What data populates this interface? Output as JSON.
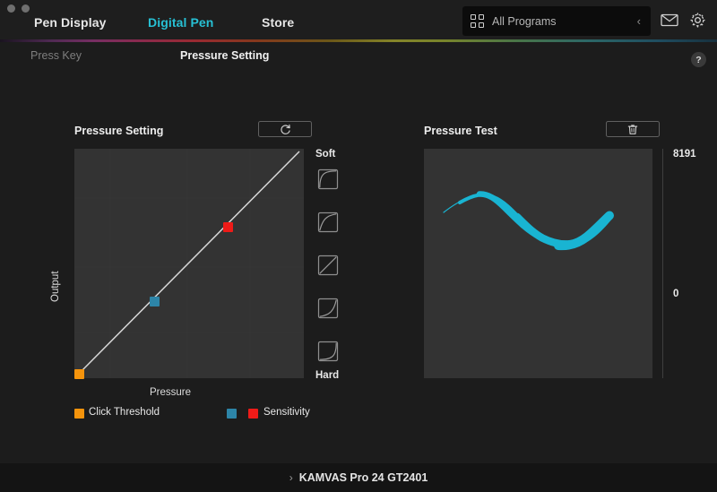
{
  "window": {
    "controls": [
      "close-dot",
      "minimize-dot"
    ]
  },
  "topnav": {
    "items": [
      {
        "label": "Pen Display",
        "active": false
      },
      {
        "label": "Digital Pen",
        "active": true
      },
      {
        "label": "Store",
        "active": false
      }
    ],
    "program_selector": {
      "icon": "grid-icon",
      "label": "All Programs",
      "chevron": "‹"
    },
    "mail_icon": "mail-icon",
    "settings_icon": "gear-icon",
    "accent_color": "#27c0d4"
  },
  "subnav": {
    "items": [
      {
        "label": "Press Key",
        "active": false
      },
      {
        "label": "Pressure Setting",
        "active": true
      }
    ],
    "help_label": "?"
  },
  "pressure_setting": {
    "title": "Pressure Setting",
    "reset_icon": "refresh-icon",
    "axis_y": "Output",
    "axis_x": "Pressure",
    "soft_label": "Soft",
    "hard_label": "Hard",
    "presets": [
      {
        "name": "preset-soft-1",
        "shape": "concave-strong"
      },
      {
        "name": "preset-soft-2",
        "shape": "concave-light"
      },
      {
        "name": "preset-linear",
        "shape": "linear"
      },
      {
        "name": "preset-hard-2",
        "shape": "convex-light"
      },
      {
        "name": "preset-hard-1",
        "shape": "convex-strong"
      }
    ],
    "legend": [
      {
        "label": "Click Threshold",
        "colors": [
          "#f5940c"
        ]
      },
      {
        "label": "Sensitivity",
        "colors": [
          "#2d85a8",
          "#ee1b18"
        ]
      }
    ],
    "colors": {
      "click_threshold": "#f5940c",
      "sensitivity_low": "#2d85a8",
      "sensitivity_high": "#ee1b18",
      "curve_line": "#d8d8d8",
      "graph_bg": "#333333"
    }
  },
  "pressure_test": {
    "title": "Pressure Test",
    "clear_icon": "trash-icon",
    "scale_max": "8191",
    "scale_min": "0",
    "stroke_color": "#19b4d2"
  },
  "statusbar": {
    "chevron": "›",
    "device": "KAMVAS Pro 24 GT2401"
  },
  "chart_data": {
    "type": "line",
    "title": "Pressure Setting",
    "xlabel": "Pressure",
    "ylabel": "Output",
    "xlim": [
      0,
      100
    ],
    "ylim": [
      0,
      100
    ],
    "grid": false,
    "series": [
      {
        "name": "Pressure Curve",
        "x": [
          0,
          100
        ],
        "y": [
          0,
          100
        ],
        "color": "#d8d8d8"
      }
    ],
    "control_points": [
      {
        "name": "Click Threshold",
        "x": 1.5,
        "y": 1.5,
        "color": "#f5940c"
      },
      {
        "name": "Sensitivity Low",
        "x": 34,
        "y": 34,
        "color": "#2d85a8"
      },
      {
        "name": "Sensitivity High",
        "x": 67,
        "y": 67,
        "color": "#ee1b18"
      }
    ]
  }
}
